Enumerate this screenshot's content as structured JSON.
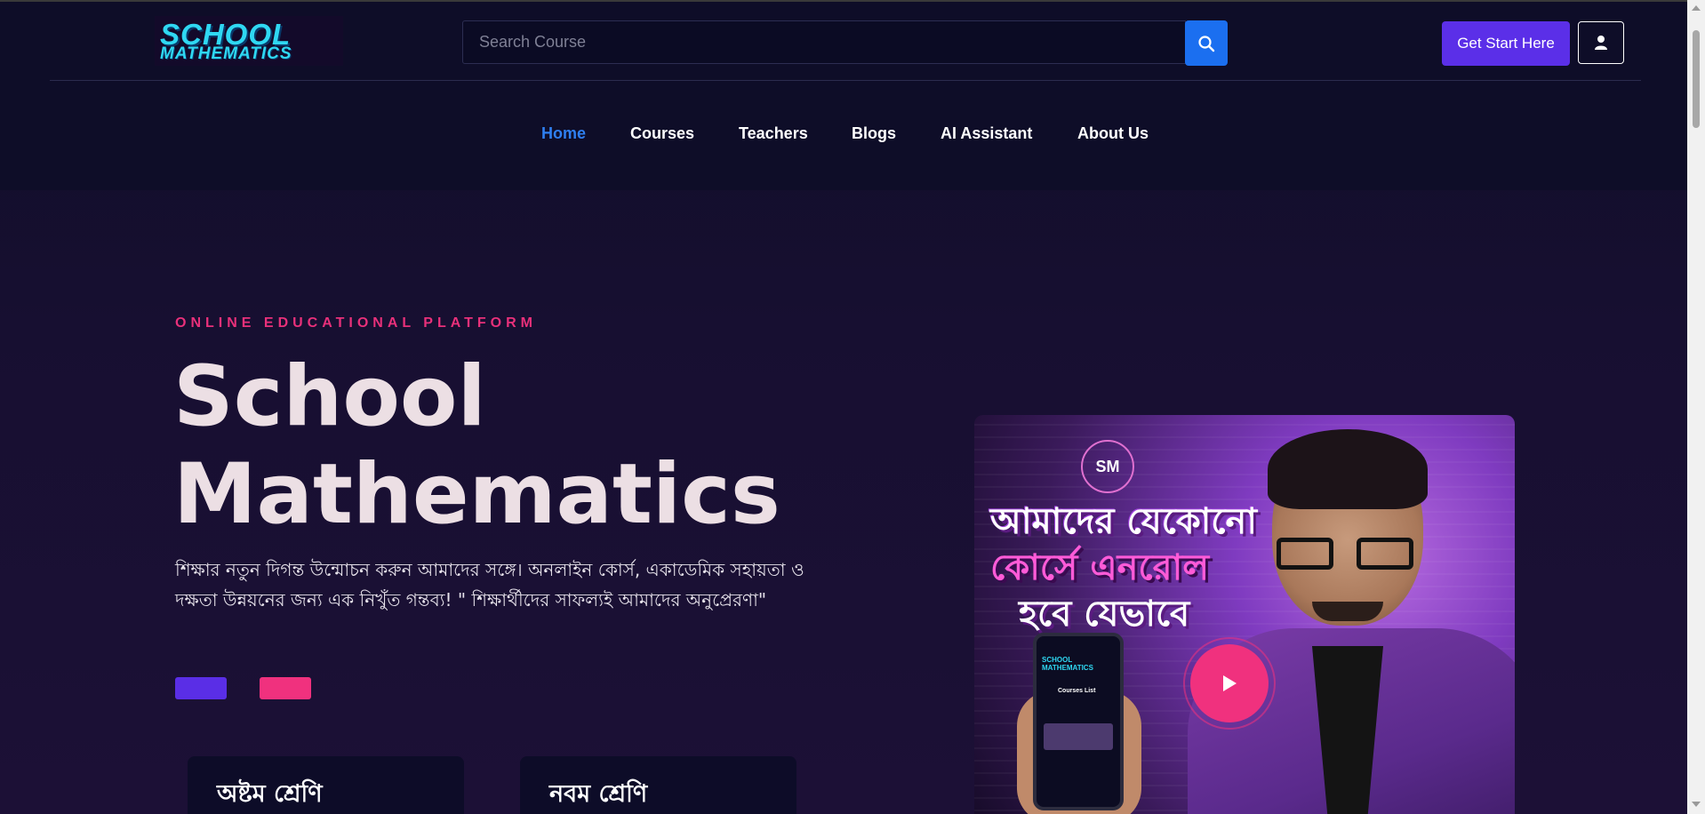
{
  "brand": {
    "logo_line1": "SCHOOL",
    "logo_line2": "MATHEMATICS"
  },
  "search": {
    "placeholder": "Search Course",
    "value": "",
    "icon": "search-icon"
  },
  "header": {
    "cta_label": "Get Start Here",
    "user_icon": "user-icon"
  },
  "nav": {
    "items": [
      {
        "label": "Home",
        "active": true
      },
      {
        "label": "Courses",
        "active": false
      },
      {
        "label": "Teachers",
        "active": false
      },
      {
        "label": "Blogs",
        "active": false
      },
      {
        "label": "AI Assistant",
        "active": false
      },
      {
        "label": "About Us",
        "active": false
      }
    ]
  },
  "hero": {
    "eyebrow": "ONLINE EDUCATIONAL PLATFORM",
    "title_line1": "School",
    "title_line2": "Mathematics",
    "description": "শিক্ষার নতুন দিগন্ত উন্মোচন করুন আমাদের সঙ্গে। অনলাইন কোর্স, একাডেমিক সহায়তা ও দক্ষতা উন্নয়নের জন্য এক নিখুঁত গন্তব্য! \" শিক্ষার্থীদের সাফল্যই আমাদের অনুপ্রেরণা\""
  },
  "classes": [
    {
      "title": "অষ্টম শ্রেণি"
    },
    {
      "title": "নবম শ্রেণি"
    }
  ],
  "video": {
    "caption_line1": "আমাদের যেকোনো",
    "caption_line2": "কোর্সে এনরোল",
    "caption_line3": "হবে যেভাবে",
    "seal_text": "SM",
    "phone_logo_line1": "SCHOOL",
    "phone_logo_line2": "MATHEMATICS",
    "phone_screen_title": "Courses List",
    "play_icon": "play-icon"
  },
  "colors": {
    "accent_blue": "#1b6ff0",
    "accent_purple": "#5b2fe8",
    "accent_pink": "#f0317e",
    "logo_cyan": "#2fd8f2"
  }
}
